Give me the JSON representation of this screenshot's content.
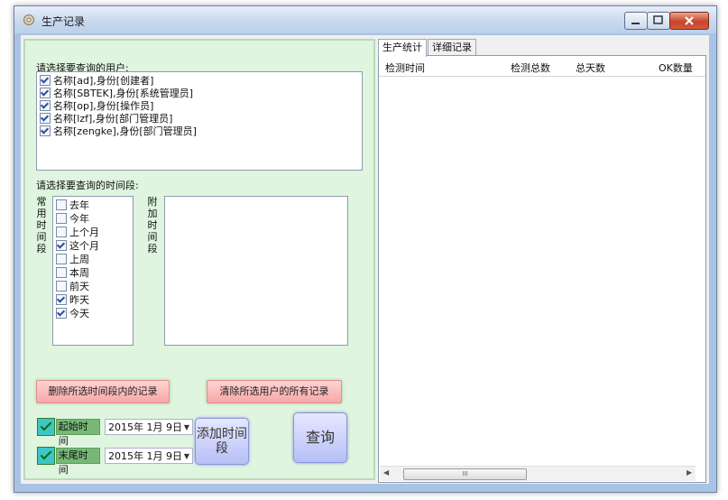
{
  "window": {
    "title": "生产记录"
  },
  "left": {
    "users_label": "请选择要查询的用户:",
    "users": [
      {
        "label": "名称[ad],身份[创建者]",
        "checked": true
      },
      {
        "label": "名称[SBTEK],身份[系统管理员]",
        "checked": true
      },
      {
        "label": "名称[op],身份[操作员]",
        "checked": true
      },
      {
        "label": "名称[lzf],身份[部门管理员]",
        "checked": true
      },
      {
        "label": "名称[zengke],身份[部门管理员]",
        "checked": true
      }
    ],
    "period_label": "请选择要查询的时间段:",
    "common_label": [
      "常",
      "用",
      "时",
      "间",
      "段"
    ],
    "extra_label": [
      "附",
      "加",
      "时",
      "间",
      "段"
    ],
    "periods": [
      {
        "label": "去年",
        "checked": false
      },
      {
        "label": "今年",
        "checked": false
      },
      {
        "label": "上个月",
        "checked": false
      },
      {
        "label": "这个月",
        "checked": true
      },
      {
        "label": "上周",
        "checked": false
      },
      {
        "label": "本周",
        "checked": false
      },
      {
        "label": "前天",
        "checked": false
      },
      {
        "label": "昨天",
        "checked": true
      },
      {
        "label": "今天",
        "checked": true
      }
    ],
    "delete_period_button": "删除所选时间段内的记录",
    "clear_user_button": "清除所选用户的所有记录",
    "start": {
      "label": "起始时间",
      "date": "2015年 1月 9日"
    },
    "end": {
      "label": "末尾时间",
      "date": "2015年 1月 9日"
    },
    "add_period_button": "添加时间段",
    "query_button": "查询"
  },
  "right": {
    "tabs": [
      "生产统计",
      "详细记录"
    ],
    "columns": [
      "检测时间",
      "检测总数",
      "总天数",
      "OK数量"
    ],
    "scroll_thumb": "III"
  }
}
